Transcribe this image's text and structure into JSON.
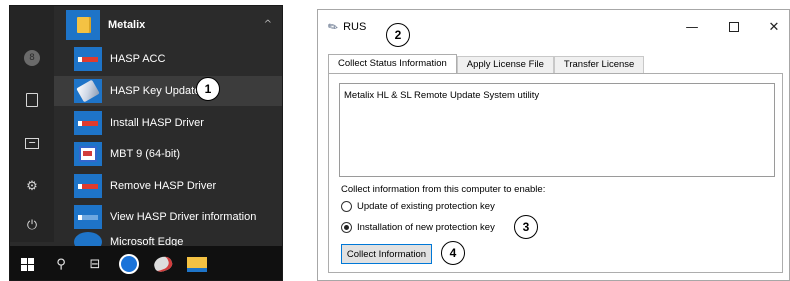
{
  "start_menu": {
    "folder": {
      "label": "Metalix",
      "icon": "folder-icon",
      "expand_icon": "chevron-up-icon"
    },
    "items": [
      {
        "label": "HASP ACC",
        "icon": "hasp-app-icon"
      },
      {
        "label": "HASP Key Update",
        "icon": "key-update-icon"
      },
      {
        "label": "Install HASP Driver",
        "icon": "hasp-app-icon"
      },
      {
        "label": "MBT 9 (64-bit)",
        "icon": "mbt-app-icon"
      },
      {
        "label": "Remove HASP Driver",
        "icon": "hasp-app-icon"
      },
      {
        "label": "View HASP Driver information",
        "icon": "hasp-info-icon"
      }
    ],
    "partial_item": {
      "label": "Microsoft Edge"
    },
    "rail_icons": [
      "user-icon",
      "document-icon",
      "pictures-icon",
      "settings-icon",
      "power-icon"
    ],
    "rail_user_initial": "8",
    "taskbar_icons": [
      "windows-start-icon",
      "search-icon",
      "task-view-icon",
      "teamviewer-icon",
      "paint-icon",
      "file-explorer-icon"
    ]
  },
  "callouts": {
    "one": "1",
    "two": "2",
    "three": "3",
    "four": "4"
  },
  "dialog": {
    "title": "RUS",
    "controls": {
      "minimize": "—",
      "close": "✕"
    },
    "tabs": [
      {
        "label": "Collect Status Information",
        "active": true
      },
      {
        "label": "Apply License File",
        "active": false
      },
      {
        "label": "Transfer License",
        "active": false
      }
    ],
    "text_area": "Metalix HL & SL Remote Update System utility",
    "collect_label": "Collect information from this computer to enable:",
    "options": [
      {
        "label": "Update of existing protection key",
        "selected": false
      },
      {
        "label": "Installation of new protection key",
        "selected": true
      }
    ],
    "button_label": "Collect Information",
    "accent_color": "#0078d7"
  }
}
